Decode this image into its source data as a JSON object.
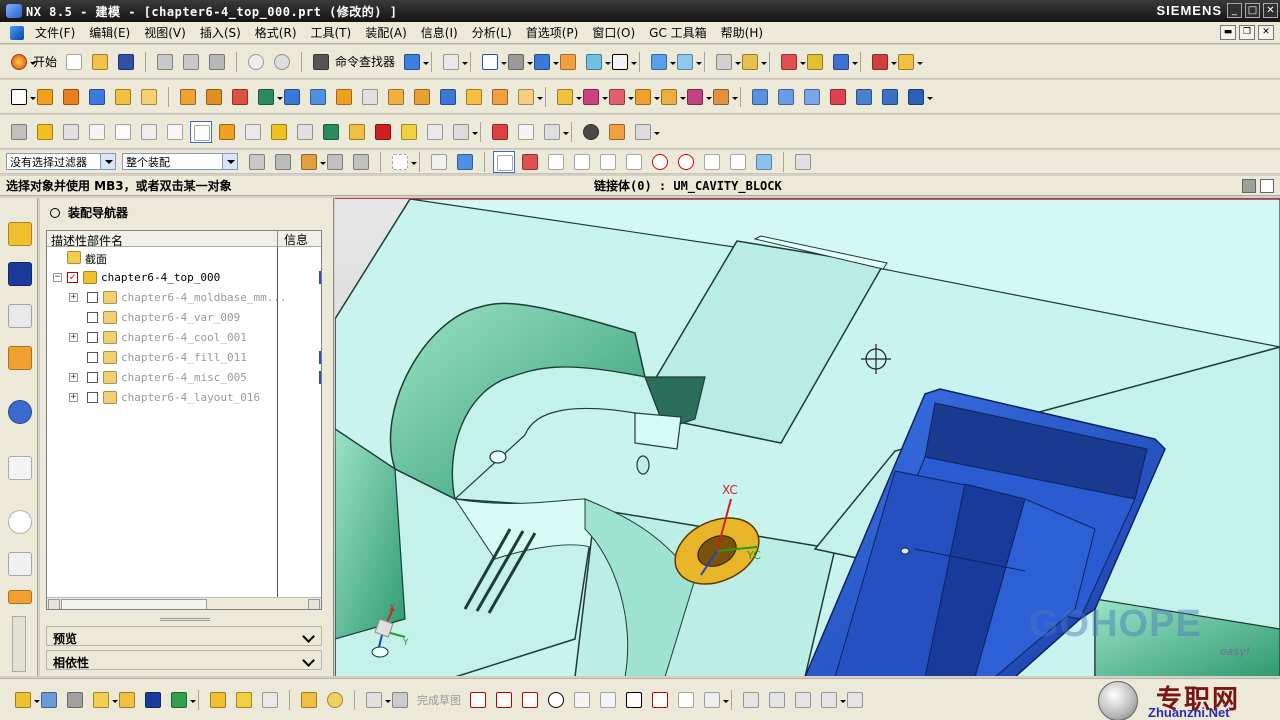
{
  "titlebar": {
    "title": "NX 8.5 - 建模 - [chapter6-4_top_000.prt (修改的) ]",
    "brand": "SIEMENS",
    "buttons": [
      "_",
      "□",
      "✕"
    ]
  },
  "menubar": {
    "items": [
      "文件(F)",
      "编辑(E)",
      "视图(V)",
      "插入(S)",
      "格式(R)",
      "工具(T)",
      "装配(A)",
      "信息(I)",
      "分析(L)",
      "首选项(P)",
      "窗口(O)",
      "GC 工具箱",
      "帮助(H)"
    ],
    "mdi_buttons": [
      "▬",
      "❐",
      "✕"
    ]
  },
  "toolbar1": {
    "start_label": "开始",
    "command_finder_label": "命令查找器"
  },
  "filterbar": {
    "type_filter": "没有选择过滤器",
    "scope_filter": "整个装配"
  },
  "statusline": {
    "prompt": "选择对象并使用 MB3，或者双击某一对象",
    "status": "链接体(0) : UM_CAVITY_BLOCK"
  },
  "navigator": {
    "title": "装配导航器",
    "col_name": "描述性部件名",
    "col_info": "信息",
    "rows": [
      {
        "label": "截面",
        "kind": "folder"
      },
      {
        "label": "chapter6-4_top_000",
        "kind": "top"
      },
      {
        "label": "chapter6-4_moldbase_mm...",
        "kind": "child",
        "expand": true
      },
      {
        "label": "chapter6-4_var_009",
        "kind": "child",
        "expand": false
      },
      {
        "label": "chapter6-4_cool_001",
        "kind": "child",
        "expand": true
      },
      {
        "label": "chapter6-4_fill_011",
        "kind": "child",
        "expand": false
      },
      {
        "label": "chapter6-4_misc_005",
        "kind": "child",
        "expand": true
      },
      {
        "label": "chapter6-4_layout_016",
        "kind": "child",
        "expand": true
      }
    ],
    "panel_preview": "预览",
    "panel_dependency": "相依性"
  },
  "viewport": {
    "axis_xc": "XC",
    "axis_yc": "YC",
    "wcs_x": "X",
    "wcs_y": "Y",
    "watermark": "GOHOPE",
    "watermark_tag": "easy!"
  },
  "bottombar": {
    "finish_sketch_label": "完成草图",
    "site_chars": "专职网",
    "site_url": "Zhuanzhi.Net"
  },
  "colors": {
    "mold_face": "#c6f2ec",
    "mold_shadow": "#5fbf9c",
    "insert_blue": "#2f63d8",
    "gate_yellow": "#e7b320",
    "titlebar": "#1e1e1e"
  }
}
